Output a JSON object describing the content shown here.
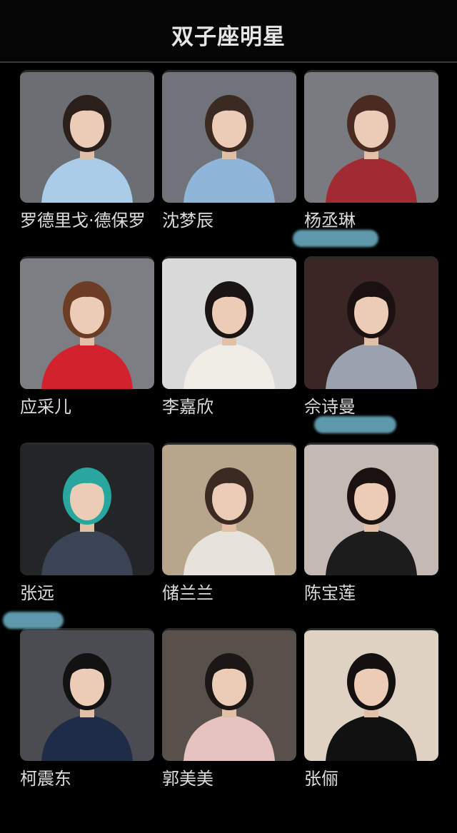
{
  "header": {
    "title": "双子座明星"
  },
  "celebrities": [
    {
      "name": "罗德里戈·德保罗",
      "photo_icon": "portrait-football-player",
      "bg": "#6b6e73",
      "shirt": "#a9cde9",
      "hair": "#2a1f1a"
    },
    {
      "name": "沈梦辰",
      "photo_icon": "portrait-woman-blue-top",
      "bg": "#70747a",
      "shirt": "#8fb6d9",
      "hair": "#3b2a22"
    },
    {
      "name": "杨丞琳",
      "photo_icon": "portrait-woman-red-jacket",
      "bg": "#7a7b80",
      "shirt": "#a12a33",
      "hair": "#4a2b22"
    },
    {
      "name": "应采儿",
      "photo_icon": "portrait-woman-red-dress",
      "bg": "#7c7e84",
      "shirt": "#d2222d",
      "hair": "#6b3d24"
    },
    {
      "name": "李嘉欣",
      "photo_icon": "portrait-woman-white-top",
      "bg": "#d9d9d9",
      "shirt": "#f0ede7",
      "hair": "#1a1412"
    },
    {
      "name": "佘诗曼",
      "photo_icon": "portrait-woman-striped-dress",
      "bg": "#3a2624",
      "shirt": "#9aa3ad",
      "hair": "#1a1210"
    },
    {
      "name": "张远",
      "photo_icon": "portrait-man-teal-hair",
      "bg": "#242526",
      "shirt": "#3a4454",
      "hair": "#2aa6a0"
    },
    {
      "name": "储兰兰",
      "photo_icon": "portrait-woman-qipao",
      "bg": "#b7a68c",
      "shirt": "#e7e3dc",
      "hair": "#3a2a22"
    },
    {
      "name": "陈宝莲",
      "photo_icon": "portrait-woman-black-dress",
      "bg": "#c4b9b3",
      "shirt": "#1c1c1c",
      "hair": "#1a1212"
    },
    {
      "name": "柯震东",
      "photo_icon": "portrait-man-suit",
      "bg": "#4a4c52",
      "shirt": "#1f2c47",
      "hair": "#121212"
    },
    {
      "name": "郭美美",
      "photo_icon": "portrait-woman-pink-top",
      "bg": "#57504b",
      "shirt": "#e7c3c0",
      "hair": "#1c1614"
    },
    {
      "name": "张俪",
      "photo_icon": "portrait-woman-black-slip-dress",
      "bg": "#e0d2c3",
      "shirt": "#111111",
      "hair": "#141010"
    }
  ],
  "colors": {
    "page_bg": "#000000",
    "text": "#dcdcdc",
    "smudge": "#6fb4c9"
  }
}
